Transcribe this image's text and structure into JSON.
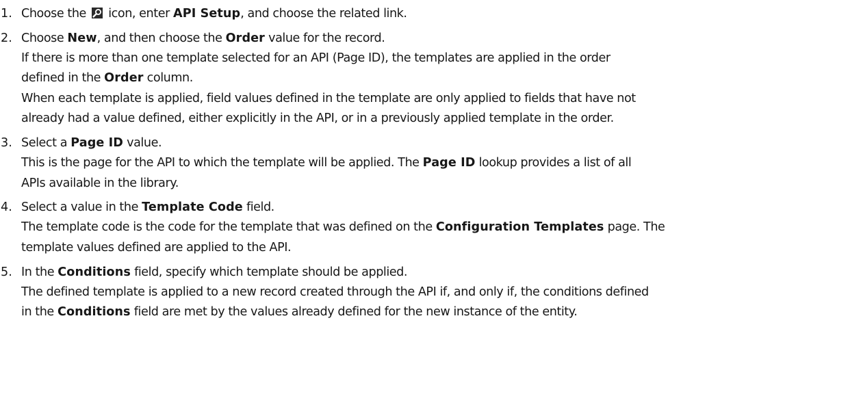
{
  "steps": [
    {
      "number": "1.",
      "lines": [
        {
          "parts": [
            {
              "t": "Choose the "
            },
            {
              "icon": "search-icon"
            },
            {
              "t": " icon, enter "
            },
            {
              "b": "API Setup"
            },
            {
              "t": ", and choose the related link."
            }
          ]
        }
      ]
    },
    {
      "number": "2.",
      "lines": [
        {
          "parts": [
            {
              "t": "Choose "
            },
            {
              "b": "New"
            },
            {
              "t": ", and then choose the "
            },
            {
              "b": "Order"
            },
            {
              "t": " value for the record."
            }
          ]
        },
        {
          "parts": [
            {
              "t": "If there is more than one template selected for an API (Page ID), the templates are applied in the order"
            }
          ]
        },
        {
          "parts": [
            {
              "t": "defined in the "
            },
            {
              "b": "Order"
            },
            {
              "t": " column."
            }
          ]
        },
        {
          "parts": [
            {
              "t": "When each template is applied, field values defined in the template are only applied to fields that have not"
            }
          ]
        },
        {
          "parts": [
            {
              "t": "already had a value defined, either explicitly in the API, or in a previously applied template in the order."
            }
          ]
        }
      ]
    },
    {
      "number": "3.",
      "lines": [
        {
          "parts": [
            {
              "t": "Select a "
            },
            {
              "b": "Page ID"
            },
            {
              "t": " value."
            }
          ]
        },
        {
          "parts": [
            {
              "t": "This is the page for the API to which the template will be applied. The "
            },
            {
              "b": "Page ID"
            },
            {
              "t": " lookup provides a list of all"
            }
          ]
        },
        {
          "parts": [
            {
              "t": "APIs available in the library."
            }
          ]
        }
      ]
    },
    {
      "number": "4.",
      "lines": [
        {
          "parts": [
            {
              "t": "Select a value in the "
            },
            {
              "b": "Template Code"
            },
            {
              "t": " field."
            }
          ]
        },
        {
          "parts": [
            {
              "t": "The template code is the code for the template that was defined on the "
            },
            {
              "b": "Configuration Templates"
            },
            {
              "t": " page. The"
            }
          ]
        },
        {
          "parts": [
            {
              "t": "template values defined are applied to the API."
            }
          ]
        }
      ]
    },
    {
      "number": "5.",
      "lines": [
        {
          "parts": [
            {
              "t": "In the "
            },
            {
              "b": "Conditions"
            },
            {
              "t": " field, specify which template should be applied."
            }
          ]
        },
        {
          "parts": [
            {
              "t": "The defined template is applied to a new record created through the API if, and only if, the conditions defined"
            }
          ]
        },
        {
          "parts": [
            {
              "t": "in the "
            },
            {
              "b": "Conditions"
            },
            {
              "t": " field are met by the values already defined for the new instance of the entity."
            }
          ]
        }
      ]
    }
  ],
  "colors": {
    "text": "#171717",
    "icon_bg": "#2b2b2b",
    "icon_fg": "#ffffff"
  }
}
